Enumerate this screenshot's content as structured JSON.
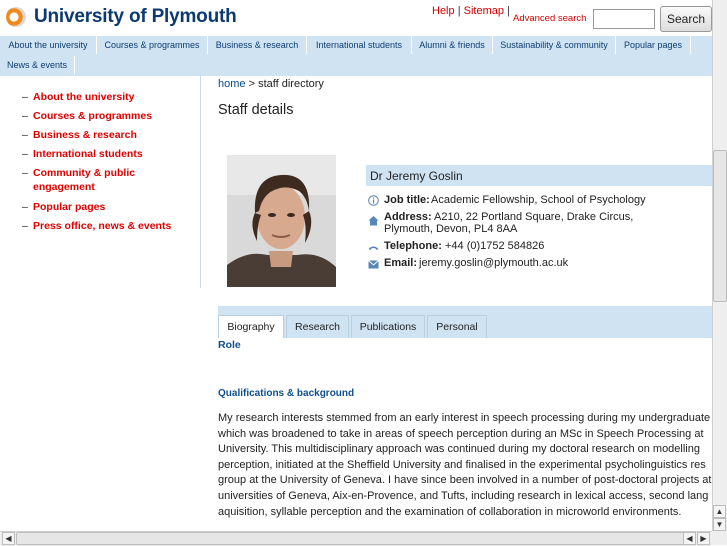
{
  "header": {
    "site_title": "University of Plymouth",
    "help": "Help",
    "sitemap": "Sitemap",
    "sep": "|",
    "advanced_search": "Advanced search",
    "search_button": "Search",
    "search_value": ""
  },
  "nav": {
    "row1": [
      "About the university",
      "Courses & programmes",
      "Business & research",
      "International students",
      "Alumni & friends",
      "Sustainability & community",
      "Popular pages"
    ],
    "row2": [
      "News & events"
    ]
  },
  "sidebar": {
    "items": [
      "About the university",
      "Courses & programmes",
      "Business & research",
      "International students",
      "Community & public engagement",
      "Popular pages",
      "Press office, news & events"
    ]
  },
  "breadcrumb": {
    "home": "home",
    "sep": ">",
    "current": "staff directory"
  },
  "page_title": "Staff details",
  "staff": {
    "name": "Dr Jeremy Goslin",
    "job_label": "Job title:",
    "job_value": "Academic Fellowship, School of Psychology",
    "address_label": "Address:",
    "address_line1": "A210, 22 Portland Square, Drake Circus,",
    "address_line2": "Plymouth, Devon, PL4 8AA",
    "phone_label": "Telephone:",
    "phone_value": "+44 (0)1752 584826",
    "email_label": "Email:",
    "email_value": "jeremy.goslin@plymouth.ac.uk"
  },
  "tabs": [
    "Biography",
    "Research",
    "Publications",
    "Personal"
  ],
  "content": {
    "role_heading": "Role",
    "qual_heading": "Qualifications & background",
    "bio_lines": [
      "My research interests stemmed from an early interest in speech processing during my undergraduate",
      "which was broadened to take in areas of speech perception during an MSc in Speech Processing at",
      "University. This multidisciplinary approach was continued during my doctoral research on modelling",
      "perception, initiated at the Sheffield University and finalised in the experimental psycholinguistics res",
      "group at the University of Geneva. I have since been involved in a number of post-doctoral projects at",
      "universities of Geneva, Aix-en-Provence, and Tufts, including research in lexical access, second lang",
      "aquisition, syllable perception and the examination of collaboration in microworld environments."
    ]
  },
  "colors": {
    "brand_blue": "#0c3a70",
    "nav_bg": "#cfe3f2",
    "link_red": "#e00000",
    "heading_blue": "#0d4f90"
  }
}
